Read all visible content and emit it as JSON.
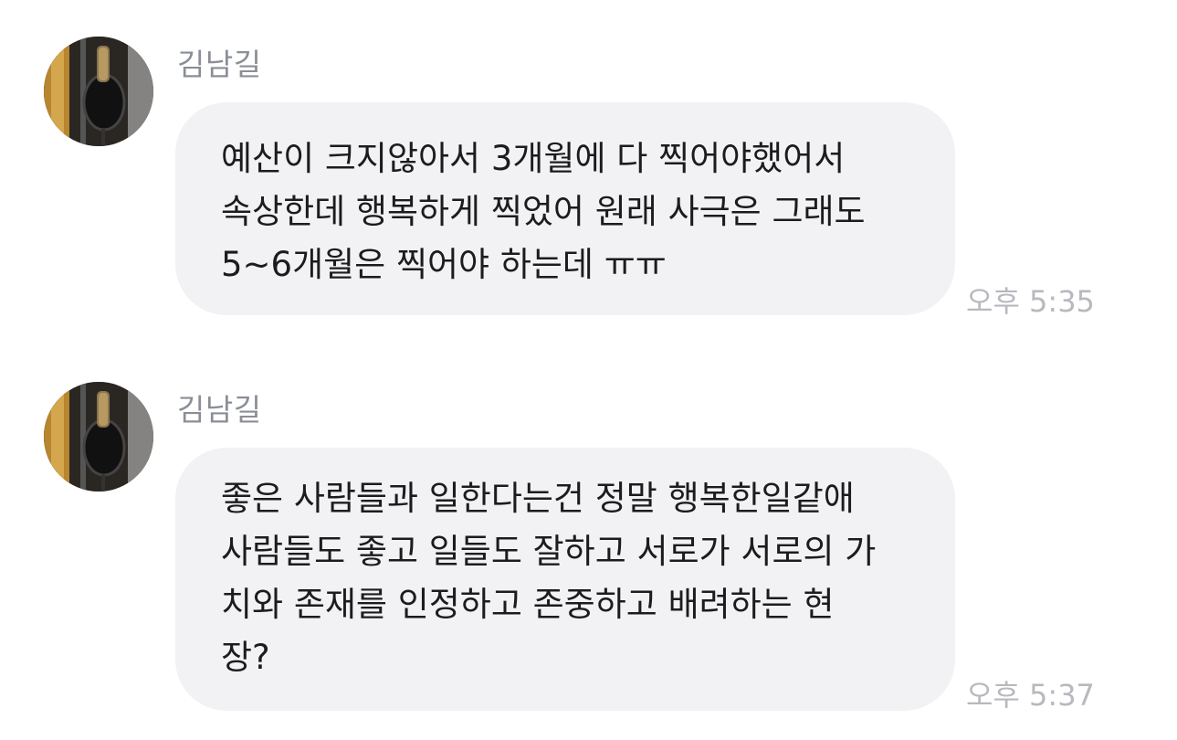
{
  "messages": [
    {
      "sender": "김남길",
      "lines": [
        "예산이 크지않아서 3개월에 다 찍어야했어서",
        "속상한데 행복하게 찍었어 원래 사극은 그래도",
        "5~6개월은 찍어야 하는데 ㅠㅠ"
      ],
      "time": "오후 5:35"
    },
    {
      "sender": "김남길",
      "lines": [
        "좋은 사람들과 일한다는건 정말 행복한일같애",
        "사람들도 좋고 일들도 잘하고 서로가 서로의 가",
        "치와 존재를 인정하고 존중하고 배려하는 현",
        "장?"
      ],
      "time": "오후 5:37"
    }
  ],
  "avatar_icon": "profile-photo-microphone"
}
